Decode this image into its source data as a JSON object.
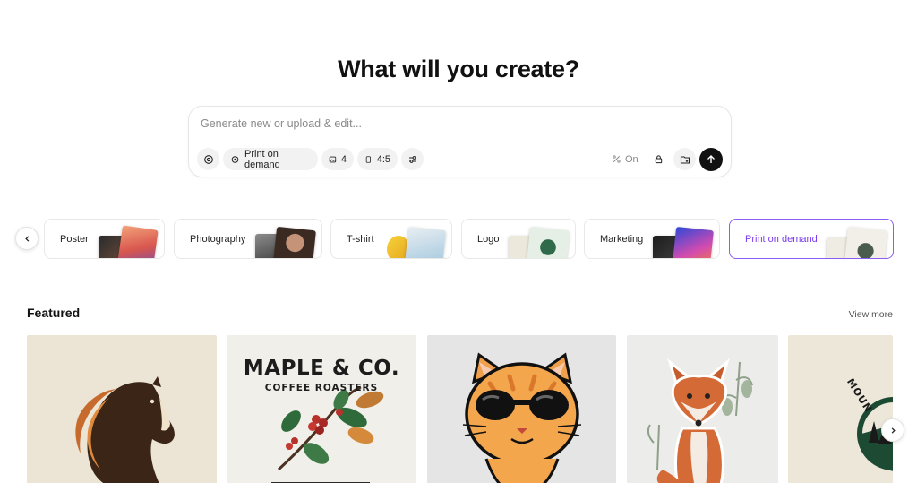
{
  "headline": "What will you create?",
  "prompt": {
    "placeholder": "Generate new or upload & edit...",
    "mode_label": "Print on demand",
    "count": "4",
    "ratio": "4:5",
    "toggle_label": "On"
  },
  "categories": [
    {
      "label": "Poster"
    },
    {
      "label": "Photography"
    },
    {
      "label": "T-shirt"
    },
    {
      "label": "Logo"
    },
    {
      "label": "Marketing"
    },
    {
      "label": "Print on demand"
    }
  ],
  "featured": {
    "title": "Featured",
    "view_more": "View more",
    "tiles": [
      {
        "name": "horse-logo"
      },
      {
        "title": "MAPLE & CO.",
        "subtitle": "COFFEE ROASTERS"
      },
      {
        "name": "cat-sunglasses"
      },
      {
        "name": "fox-sticker"
      },
      {
        "title": "MOUN"
      }
    ]
  },
  "colors": {
    "accent": "#8b5cf6",
    "send": "#111111"
  }
}
